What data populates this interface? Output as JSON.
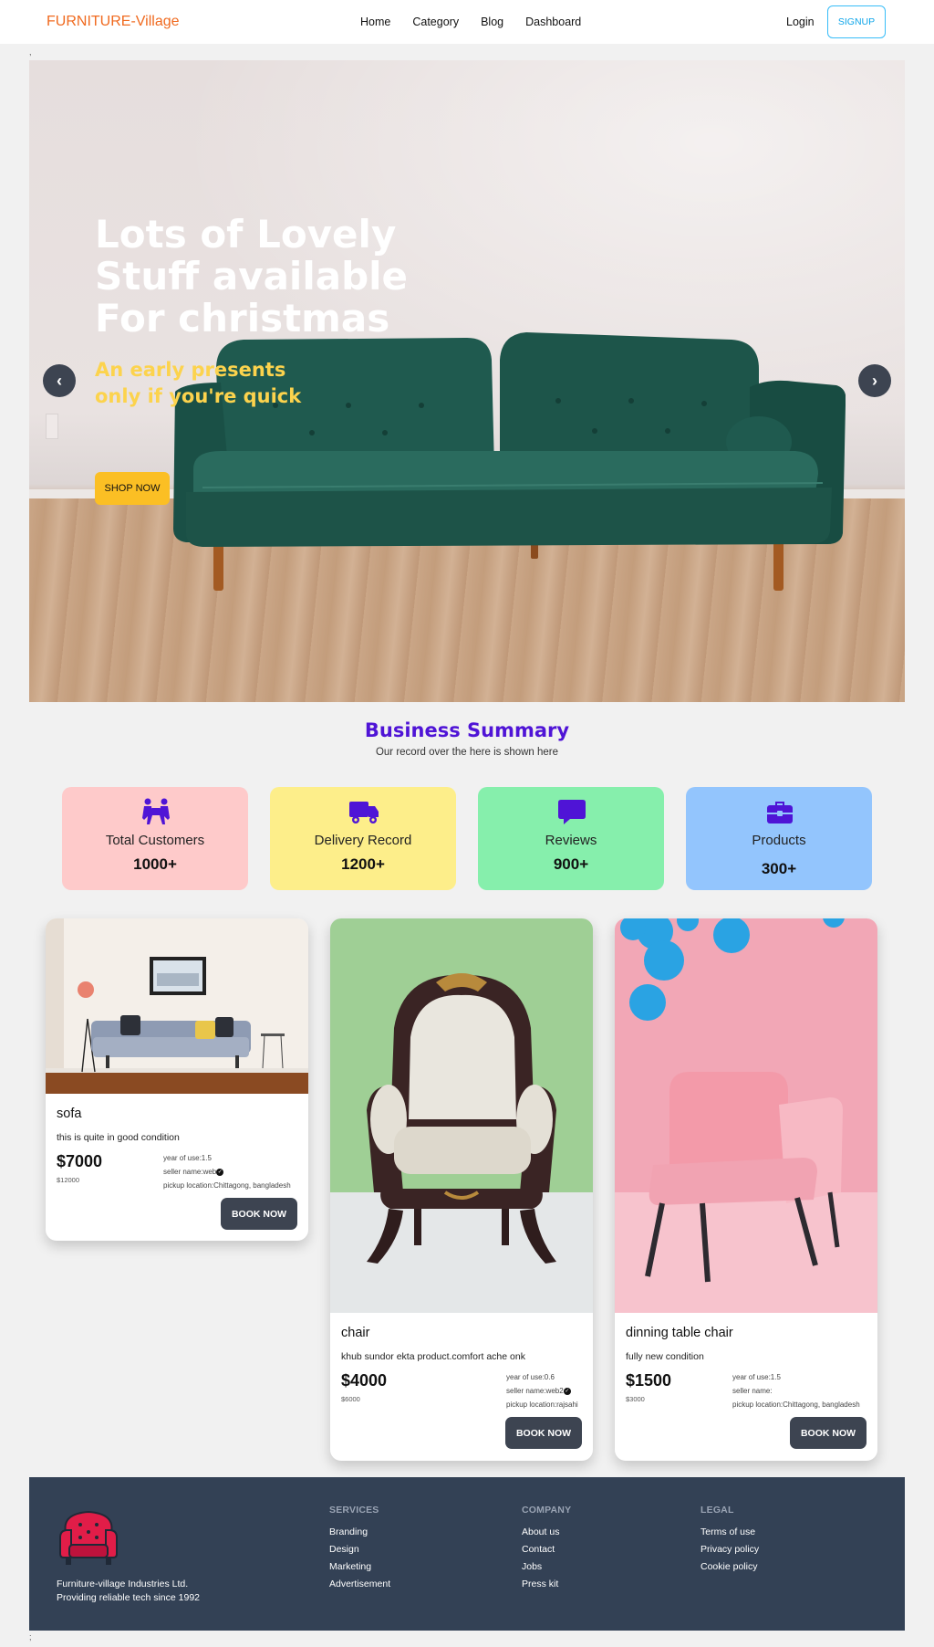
{
  "nav": {
    "brand": "FURNITURE-Village",
    "links": [
      "Home",
      "Category",
      "Blog",
      "Dashboard"
    ],
    "login": "Login",
    "signup": "SIGNUP",
    "stray_mark": ","
  },
  "hero": {
    "title": "Lots of Lovely Stuff available For christmas",
    "subtitle": "An early presents only if you're quick",
    "shop_button": "SHOP NOW",
    "prev": "‹",
    "next": "›"
  },
  "summary": {
    "title": "Business Summary",
    "subtitle": "Our record over the here is shown here",
    "stats": [
      {
        "label": "Total Customers",
        "value": "1000+",
        "icon": "people-carry-icon",
        "color": "#fecaca"
      },
      {
        "label": "Delivery Record",
        "value": "1200+",
        "icon": "truck-icon",
        "color": "#fdee8a"
      },
      {
        "label": "Reviews",
        "value": "900+",
        "icon": "comment-icon",
        "color": "#86efac"
      },
      {
        "label": "Products",
        "value": "300+",
        "icon": "toolbox-icon",
        "color": "#93c5fd"
      }
    ],
    "icon_color": "#4f14d6"
  },
  "products": [
    {
      "name": "sofa",
      "description": "this is quite in good condition",
      "price": "$7000",
      "original_price": "$12000",
      "year_of_use": "year of use:1.5",
      "seller": "seller name:web",
      "location": "pickup location:Chittagong, bangladesh",
      "button": "BOOK NOW"
    },
    {
      "name": "chair",
      "description": "khub sundor ekta product.comfort ache onk",
      "price": "$4000",
      "original_price": "$6000",
      "year_of_use": "year of use:0.6",
      "seller": "seller name:web2",
      "location": "pickup location:rajsahi",
      "button": "BOOK NOW"
    },
    {
      "name": "dinning table chair",
      "description": "fully new condition",
      "price": "$1500",
      "original_price": "$3000",
      "year_of_use": "year of use:1.5",
      "seller": "seller name:",
      "location": "pickup location:Chittagong, bangladesh",
      "button": "BOOK NOW"
    }
  ],
  "footer": {
    "company_line1": "Furniture-village Industries Ltd.",
    "company_line2": "Providing reliable tech since 1992",
    "services": {
      "title": "SERVICES",
      "items": [
        "Branding",
        "Design",
        "Marketing",
        "Advertisement"
      ]
    },
    "company": {
      "title": "COMPANY",
      "items": [
        "About us",
        "Contact",
        "Jobs",
        "Press kit"
      ]
    },
    "legal": {
      "title": "LEGAL",
      "items": [
        "Terms of use",
        "Privacy policy",
        "Cookie policy"
      ]
    },
    "stray_mark": ";"
  },
  "colors": {
    "brand": "#f06a1f",
    "accent": "#fbbf24",
    "dark": "#3d4451",
    "footer": "#334155"
  }
}
